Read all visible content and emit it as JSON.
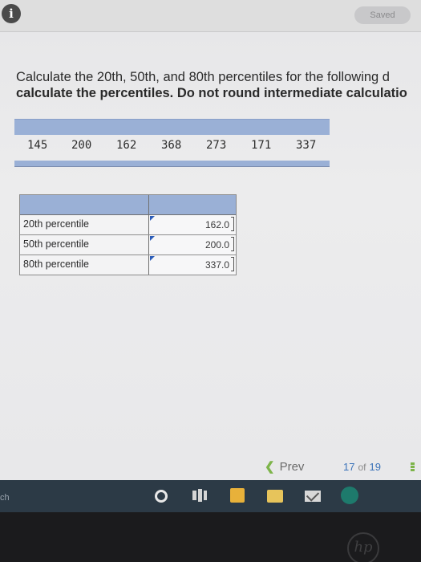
{
  "header": {
    "info_icon": "i",
    "saved_label": "Saved"
  },
  "question": {
    "line1": "Calculate the 20th, 50th, and 80th percentiles for the following d",
    "line2": "calculate the percentiles. Do not round intermediate calculatio"
  },
  "data_values": [
    "145",
    "200",
    "162",
    "368",
    "273",
    "171",
    "337"
  ],
  "percentiles": [
    {
      "label": "20th percentile",
      "value": "162.0"
    },
    {
      "label": "50th percentile",
      "value": "200.0"
    },
    {
      "label": "80th percentile",
      "value": "337.0"
    }
  ],
  "pager": {
    "prev_label": "Prev",
    "current": "17",
    "of_label": "of",
    "total": "19"
  },
  "taskbar": {
    "search_fragment": "ch"
  },
  "colors": {
    "table_header": "#9ab0d6",
    "accent_green": "#7db44a",
    "accent_blue": "#3b73b9",
    "taskbar": "#2c3a46"
  },
  "icons": [
    "info-icon",
    "chevron-left-icon",
    "grid-icon",
    "cortana-icon",
    "task-view-icon",
    "store-icon",
    "file-explorer-icon",
    "mail-icon",
    "edge-icon",
    "hp-logo-icon"
  ]
}
